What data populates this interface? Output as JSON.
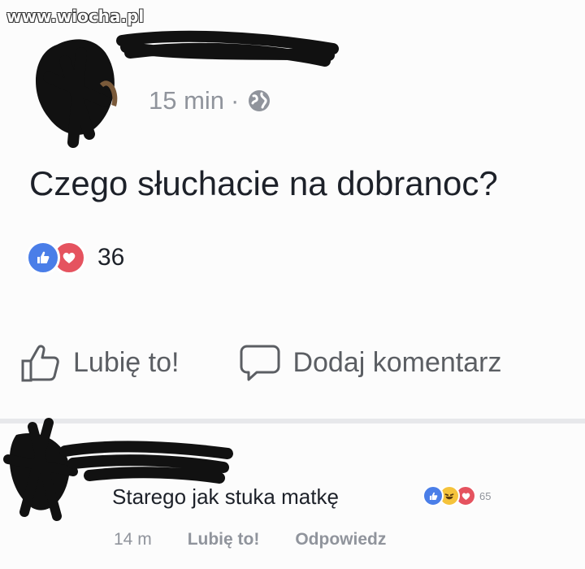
{
  "watermark": "www.wiocha.pl",
  "post": {
    "time": "15 min",
    "separator": "·",
    "privacy_icon": "globe-icon",
    "text": "Czego słuchacie na dobranoc?",
    "reactions": {
      "icons": [
        "like-reaction-icon",
        "love-reaction-icon"
      ],
      "count": "36"
    },
    "actions": {
      "like_label": "Lubię to!",
      "comment_label": "Dodaj komentarz"
    }
  },
  "comment": {
    "text": "Starego jak stuka matkę",
    "reactions": {
      "icons": [
        "like-reaction-icon",
        "haha-reaction-icon",
        "love-reaction-icon"
      ],
      "count": "65"
    },
    "time": "14 m",
    "like_label": "Lubię to!",
    "reply_label": "Odpowiedz"
  },
  "colors": {
    "like_blue": "#4a7ee8",
    "love_red": "#e5535f",
    "haha_yellow": "#f5c33b",
    "meta_gray": "#90949c",
    "text_dark": "#1d2129"
  }
}
